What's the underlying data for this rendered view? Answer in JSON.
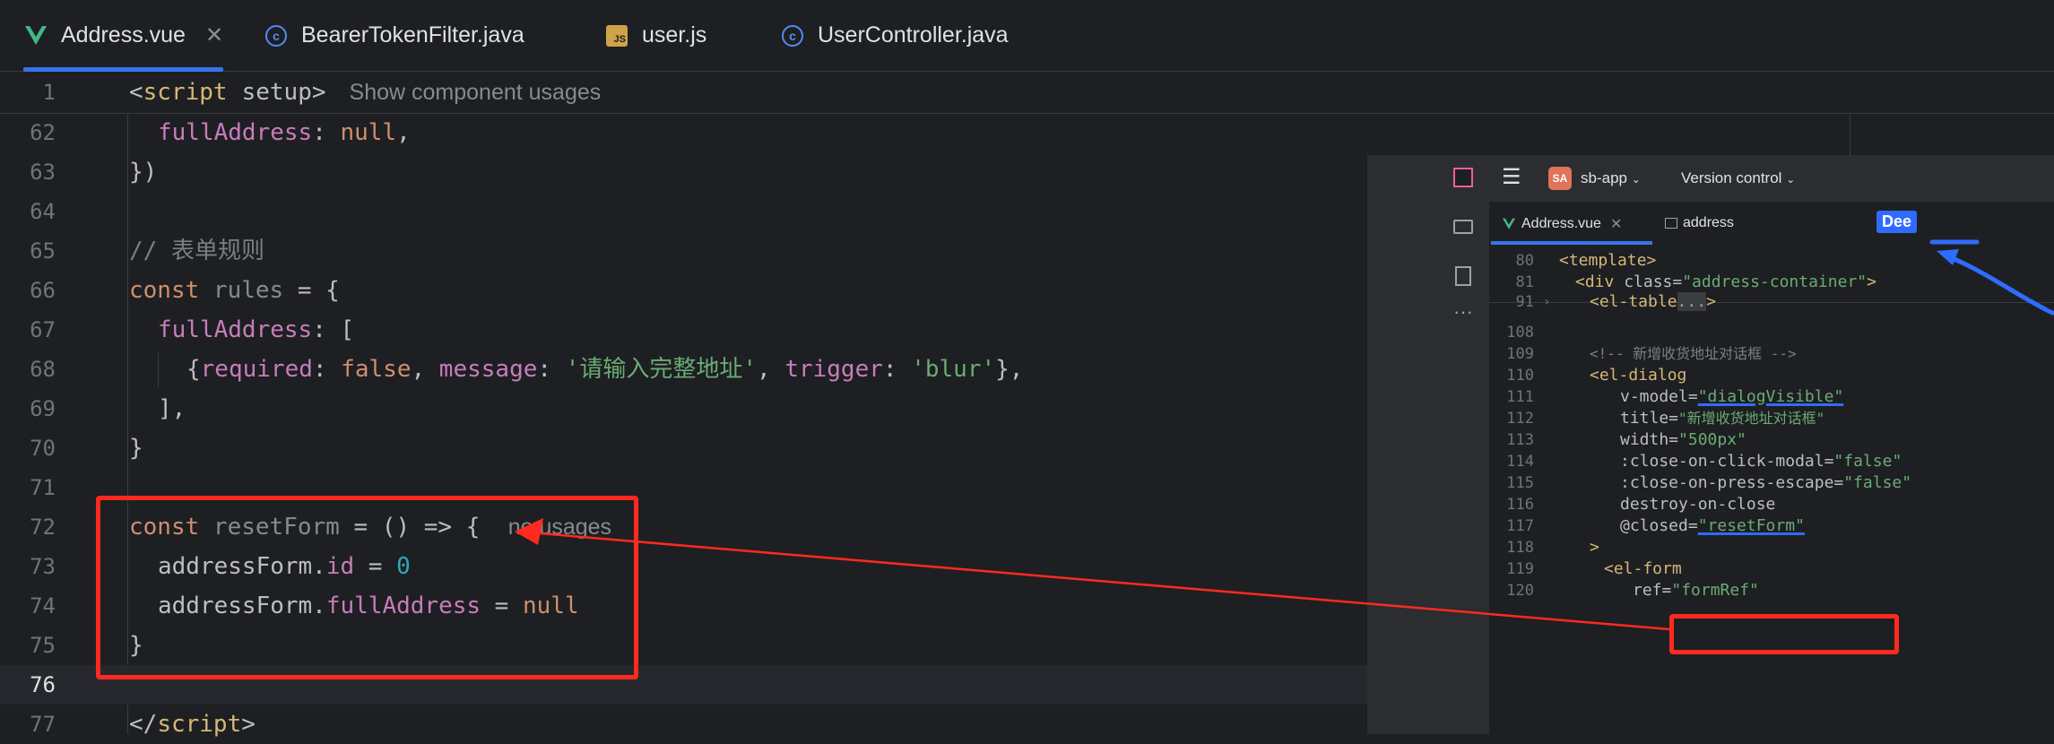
{
  "tabs": [
    {
      "label": "Address.vue",
      "icon": "vue-icon",
      "active": true
    },
    {
      "label": "BearerTokenFilter.java",
      "icon": "java-class-icon"
    },
    {
      "label": "user.js",
      "icon": "js-file-icon"
    },
    {
      "label": "UserController.java",
      "icon": "java-class-icon"
    }
  ],
  "sticky": {
    "num": "1",
    "tag_open": "<",
    "tag_name": "script",
    "attr": "setup",
    "tag_close": ">",
    "hint": "Show component usages"
  },
  "lines": {
    "n62": "62",
    "n63": "63",
    "n64": "64",
    "n65": "65",
    "n66": "66",
    "n67": "67",
    "n68": "68",
    "n69": "69",
    "n70": "70",
    "n71": "71",
    "n72": "72",
    "n73": "73",
    "n74": "74",
    "n75": "75",
    "n76": "76",
    "n77": "77",
    "l62_prop": "fullAddress",
    "l62_colon": ": ",
    "l62_null": "null",
    "l62_comma": ",",
    "l63": "})",
    "l65": "// 表单规则",
    "l66_const": "const",
    "l66_name": " rules",
    "l66_rest": " = {",
    "l67_prop": "fullAddress",
    "l67_rest": ": [",
    "l68_open": "{",
    "l68_req": "required",
    "l68_c1": ": ",
    "l68_false": "false",
    "l68_c2": ", ",
    "l68_msg": "message",
    "l68_c3": ": ",
    "l68_str": "'请输入完整地址'",
    "l68_c4": ", ",
    "l68_trig": "trigger",
    "l68_c5": ": ",
    "l68_blur": "'blur'",
    "l68_close": "},",
    "l69": "],",
    "l70": "}",
    "l72_const": "const",
    "l72_name": " resetForm",
    "l72_rest": " = () => {",
    "l72_hint": "no usages",
    "l73_obj": "addressForm.",
    "l73_prop": "id",
    "l73_eq": " = ",
    "l73_num": "0",
    "l74_obj": "addressForm.",
    "l74_prop": "fullAddress",
    "l74_eq": " = ",
    "l74_null": "null",
    "l75": "}",
    "l77_open": "</",
    "l77_name": "script",
    "l77_close": ">"
  },
  "overlay": {
    "project_badge": "SA",
    "project": "sb-app",
    "vcs": "Version control",
    "tab1": "Address.vue",
    "tab2": "address",
    "tag_label": "Dee",
    "rows": {
      "g80": "80",
      "g81": "81",
      "g91": "91",
      "g108": "108",
      "g109": "109",
      "g110": "110",
      "g111": "111",
      "g112": "112",
      "g113": "113",
      "g114": "114",
      "g115": "115",
      "g116": "116",
      "g117": "117",
      "g118": "118",
      "g119": "119",
      "g120": "120",
      "r80": "<template>",
      "r81_a": "<div ",
      "r81_b": "class=",
      "r81_c": "\"address-container\"",
      "r81_d": ">",
      "r91_a": "<el-table",
      "r91_b": "...",
      "r91_c": ">",
      "r109": "<!-- 新增收货地址对话框 -->",
      "r110": "<el-dialog",
      "r111_a": "v-model=",
      "r111_b": "\"dialogVisible\"",
      "r112_a": "title=",
      "r112_b": "\"新增收货地址对话框\"",
      "r113_a": "width=",
      "r113_b": "\"500px\"",
      "r114_a": ":close-on-click-modal=",
      "r114_b": "\"false\"",
      "r115_a": ":close-on-press-escape=",
      "r115_b": "\"false\"",
      "r116": "destroy-on-close",
      "r117_a": "@closed=",
      "r117_b": "\"resetForm\"",
      "r118": ">",
      "r119": "<el-form",
      "r120_a": "ref=",
      "r120_b": "\"formRef\""
    }
  },
  "colors": {
    "accent": "#3574f0",
    "annotation": "#ff2a1f",
    "pen": "#2f6bff",
    "vue_green": "#41b883"
  }
}
